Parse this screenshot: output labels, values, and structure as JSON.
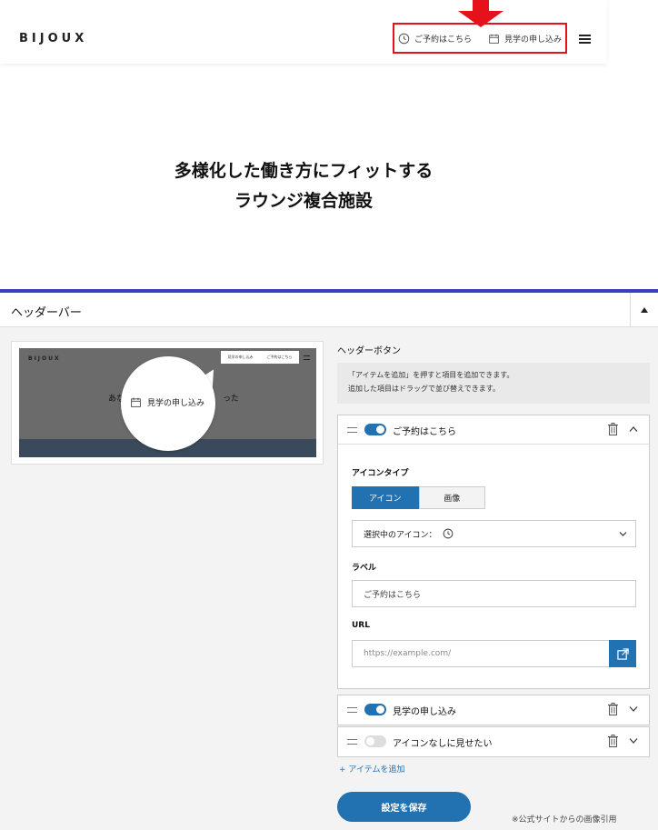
{
  "site": {
    "logo": "BIJOUX",
    "nav": [
      {
        "label": "ご予約はこちら",
        "icon": "clock-icon"
      },
      {
        "label": "見学の申し込み",
        "icon": "calendar-icon"
      }
    ],
    "hero_line1": "多様化した働き方にフィットする",
    "hero_line2": "ラウンジ複合施設",
    "highlight_color": "#e6121b"
  },
  "panel": {
    "title": "ヘッダーバー",
    "section_title": "ヘッダーボタン",
    "info_line1": "「アイテムを追加」を押すと項目を追加できます。",
    "info_line2": "追加した項目はドラッグで並び替えできます。",
    "preview": {
      "logo": "BIJOUX",
      "nav1": "見学の申し込み",
      "nav2": "ご予約はこちら",
      "hero_left": "あな",
      "hero_right": "った",
      "bubble_label": "見学の申し込み"
    },
    "items": [
      {
        "label": "ご予約はこちら",
        "enabled": true
      },
      {
        "label": "見学の申し込み",
        "enabled": true
      },
      {
        "label": "アイコンなしに見せたい",
        "enabled": false
      }
    ],
    "editor": {
      "icon_type_label": "アイコンタイプ",
      "icon_type_options": [
        "アイコン",
        "画像"
      ],
      "selected_icon_label": "選択中のアイコン：",
      "label_label": "ラベル",
      "label_value": "ご予約はこちら",
      "url_label": "URL",
      "url_placeholder": "https://example.com/"
    },
    "add_item": "+ アイテムを追加",
    "save": "設定を保存",
    "accent_color": "#2271b1"
  },
  "credit": "※公式サイトからの画像引用"
}
